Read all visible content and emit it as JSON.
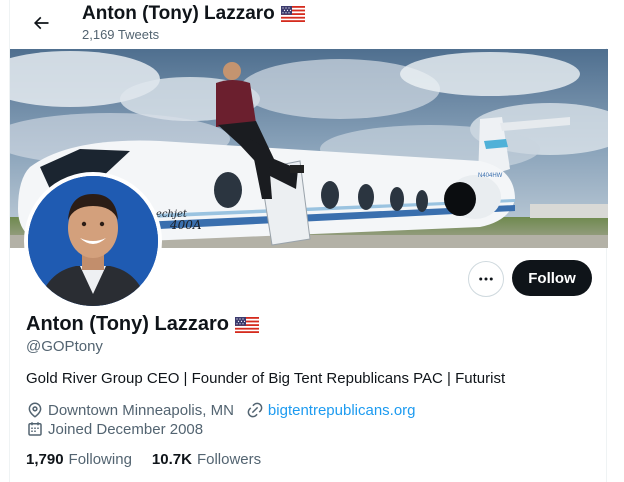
{
  "header": {
    "name": "Anton (Tony) Lazzaro",
    "tweet_count": "2,169 Tweets"
  },
  "actions": {
    "follow_label": "Follow"
  },
  "profile": {
    "name": "Anton (Tony) Lazzaro",
    "handle": "@GOPtony",
    "bio": "Gold River Group CEO | Founder of Big Tent Republicans PAC | Futurist",
    "location": "Downtown Minneapolis, MN",
    "website": "bigtentrepublicans.org",
    "joined": "Joined December 2008"
  },
  "stats": {
    "following_count": "1,790",
    "following_label": "Following",
    "followers_count": "10.7K",
    "followers_label": "Followers"
  },
  "banner": {
    "tail_text": "N404HW",
    "nose_text": "eechjet",
    "nose_num": "400A"
  },
  "icons": {
    "back": "arrow-left-icon",
    "flag": "us-flag-icon",
    "more": "ellipsis-icon",
    "location": "location-pin-icon",
    "link": "link-icon",
    "calendar": "calendar-icon"
  },
  "colors": {
    "accent": "#1d9bf0",
    "text": "#0f1419",
    "muted": "#536471",
    "button_dark": "#0f1419"
  }
}
